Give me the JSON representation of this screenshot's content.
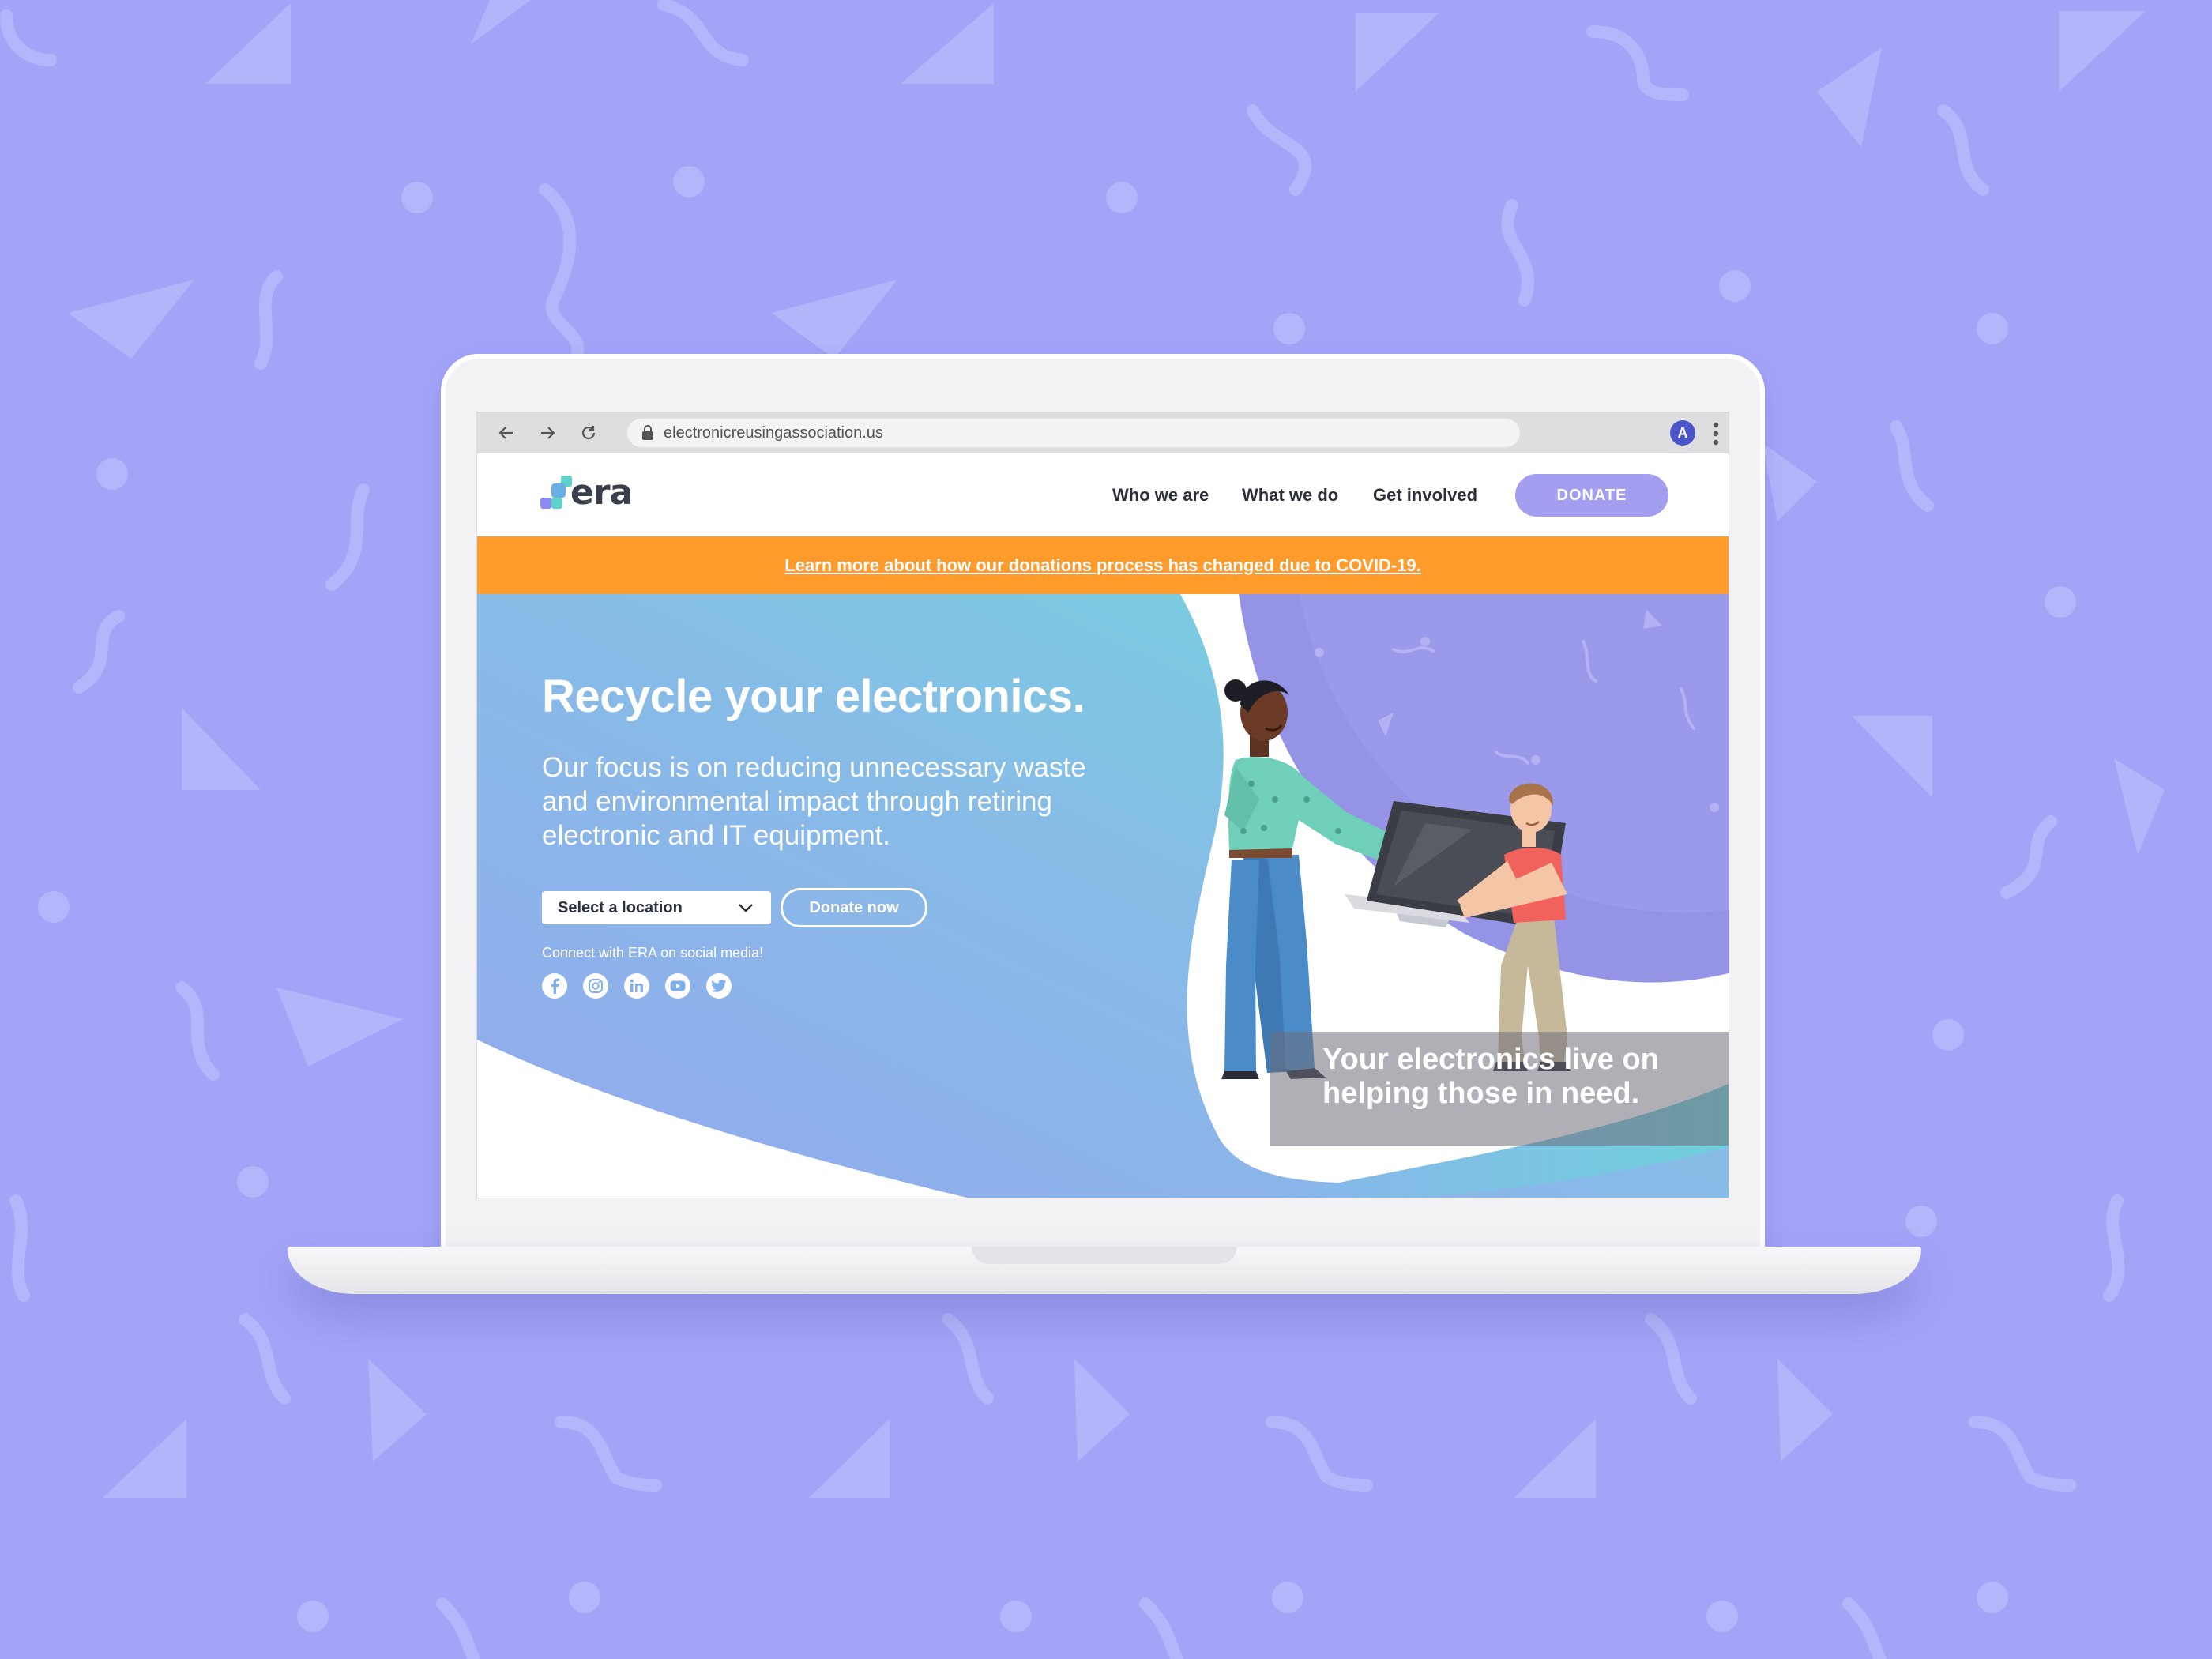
{
  "browser": {
    "url": "electronicreusingassociation.us",
    "profile_initial": "A"
  },
  "site": {
    "logo_text": "era",
    "nav": [
      {
        "label": "Who we are"
      },
      {
        "label": "What we do"
      },
      {
        "label": "Get involved"
      }
    ],
    "donate_button": "DONATE"
  },
  "banner": {
    "text": "Learn more about how our donations process has changed due to COVID-19."
  },
  "hero": {
    "title": "Recycle your electronics.",
    "subtitle": "Our focus is on reducing unnecessary waste and environmental impact through retiring electronic and IT equipment.",
    "location_select": {
      "selected": "Select a location"
    },
    "donate_now": "Donate now",
    "social_label": "Connect with ERA on social media!",
    "social_icons": [
      "facebook-icon",
      "instagram-icon",
      "linkedin-icon",
      "youtube-icon",
      "twitter-icon"
    ],
    "caption": "Your electronics live on helping those in need.",
    "caption_lines": [
      "Your electronics live on",
      "helping those in need."
    ]
  },
  "colors": {
    "page_background": "#a3a3f8",
    "accent": "#a39ef0",
    "banner": "#fe9b2a",
    "hero_gradient_start": "#7ed8e0",
    "hero_gradient_end": "#93a8ee"
  }
}
